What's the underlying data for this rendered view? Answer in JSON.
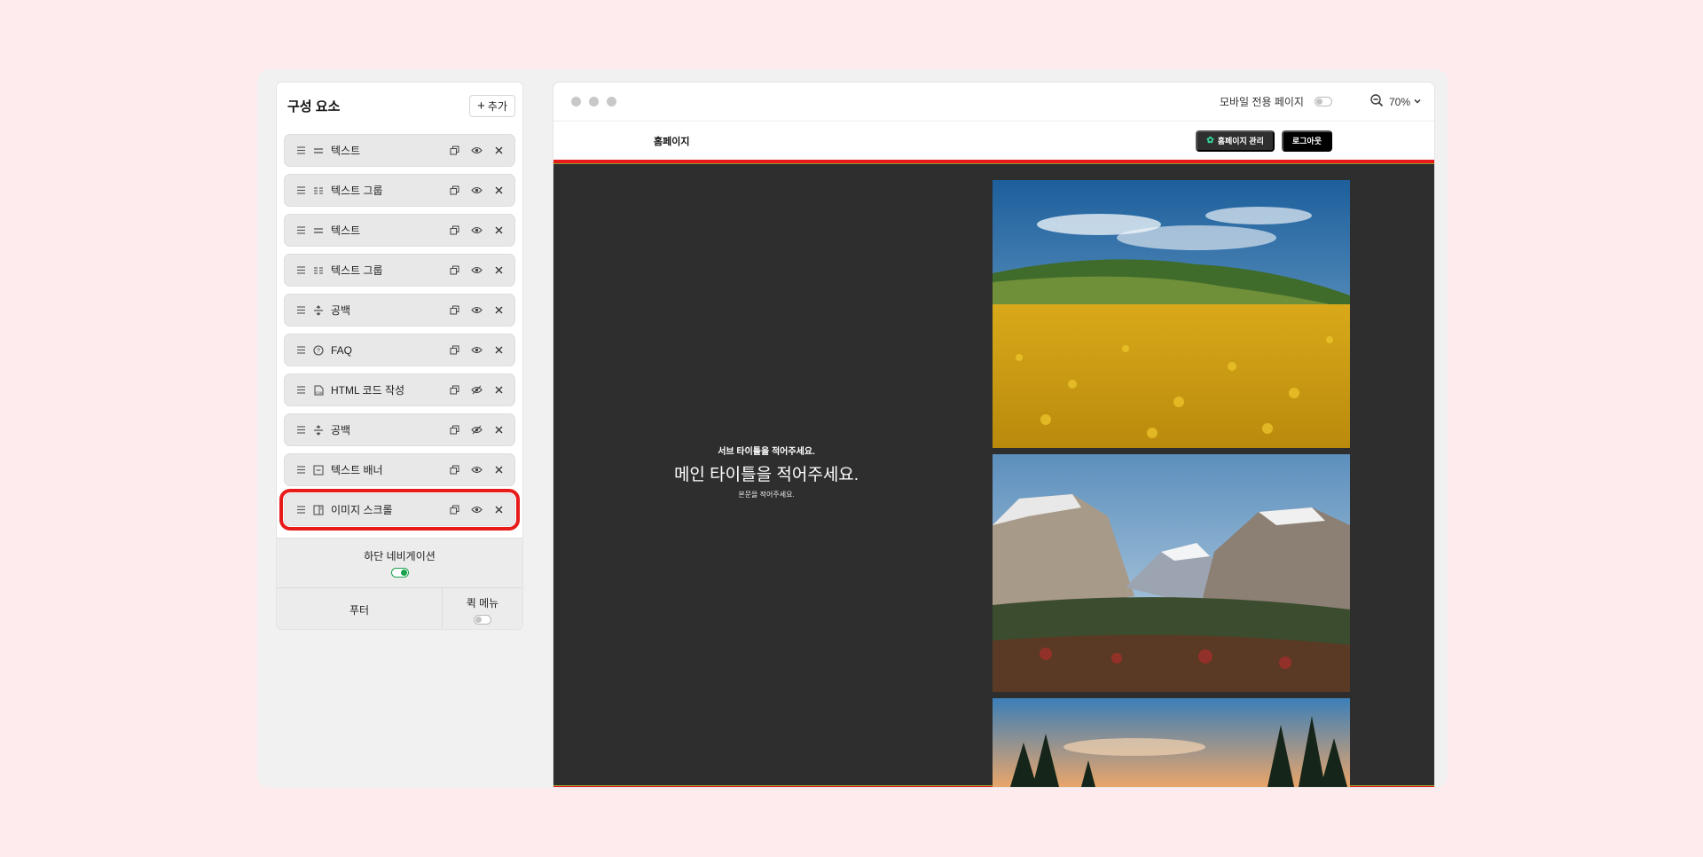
{
  "sidebar": {
    "title": "구성 요소",
    "add_label": "추가",
    "items": [
      {
        "label": "텍스트",
        "icon": "text-lines-icon",
        "hidden": false,
        "selected": false
      },
      {
        "label": "텍스트 그룹",
        "icon": "text-group-icon",
        "hidden": false,
        "selected": false
      },
      {
        "label": "텍스트",
        "icon": "text-lines-icon",
        "hidden": false,
        "selected": false
      },
      {
        "label": "텍스트 그룹",
        "icon": "text-group-icon",
        "hidden": false,
        "selected": false
      },
      {
        "label": "공백",
        "icon": "spacer-icon",
        "hidden": false,
        "selected": false
      },
      {
        "label": "FAQ",
        "icon": "question-circle-icon",
        "hidden": false,
        "selected": false
      },
      {
        "label": "HTML 코드 작성",
        "icon": "html-file-icon",
        "hidden": true,
        "selected": false
      },
      {
        "label": "공백",
        "icon": "spacer-icon",
        "hidden": true,
        "selected": false
      },
      {
        "label": "텍스트 배너",
        "icon": "text-banner-icon",
        "hidden": false,
        "selected": false
      },
      {
        "label": "이미지 스크롤",
        "icon": "image-scroll-icon",
        "hidden": false,
        "selected": true
      }
    ],
    "bottom_nav_label": "하단 네비게이션",
    "bottom_nav_enabled": true,
    "footer_label": "푸터",
    "quick_menu_label": "퀵 메뉴",
    "quick_menu_enabled": false
  },
  "preview": {
    "mobile_only_label": "모바일 전용 페이지",
    "mobile_only_enabled": false,
    "zoom": "70%",
    "site_title": "홈페이지",
    "manage_label": "홈페이지 관리",
    "logout_label": "로그아웃",
    "section": {
      "sub_title": "서브 타이틀을 적어주세요.",
      "main_title": "메인 타이틀을 적어주세요.",
      "body": "본문을 적어주세요."
    }
  },
  "colors": {
    "selection": "#e81b1b",
    "toggle_on": "#16a34a",
    "section_bg": "#2e2e2e"
  }
}
